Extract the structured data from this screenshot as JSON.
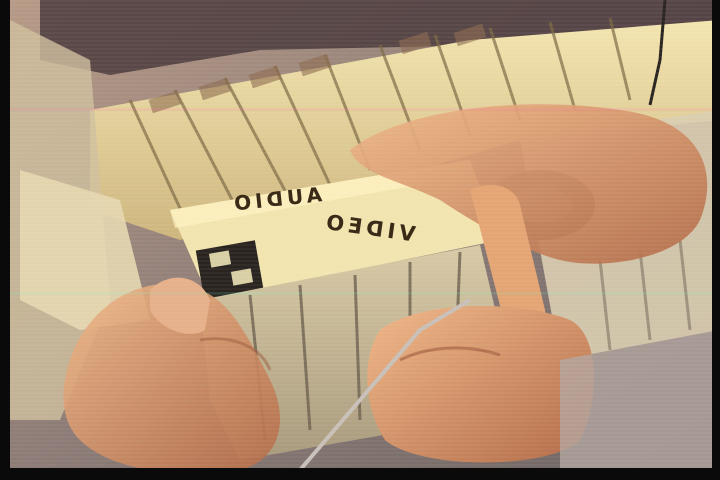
{
  "photo": {
    "subject": "hands-holding-cassette-case",
    "palette": {
      "case_cream": "#e9d8a0",
      "case_shadow": "#a08a58",
      "skin": "#d99a6a",
      "skin_shadow": "#9b5a3c",
      "background": "#8a7a78",
      "frame": "#0a0a0a"
    }
  },
  "labels": {
    "audio": "AUDIO",
    "video": "VIDEO"
  }
}
